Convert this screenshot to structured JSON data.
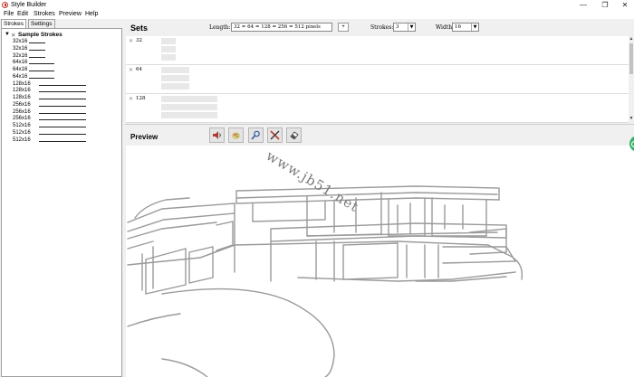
{
  "window": {
    "title": "Style Builder",
    "controls": {
      "minimize": "—",
      "maximize": "❐",
      "close": "✕"
    }
  },
  "menu": [
    "File",
    "Edit",
    "Strokes",
    "Preview",
    "Help"
  ],
  "left_panel": {
    "tabs": [
      "Strokes",
      "Settings"
    ],
    "active_tab": "Strokes",
    "tree_root": "Sample Strokes",
    "items": [
      {
        "label": "32x16",
        "stroke": "short"
      },
      {
        "label": "32x16",
        "stroke": "short"
      },
      {
        "label": "32x16",
        "stroke": "short"
      },
      {
        "label": "64x16",
        "stroke": "medium"
      },
      {
        "label": "64x16",
        "stroke": "medium"
      },
      {
        "label": "64x16",
        "stroke": "medium"
      },
      {
        "label": "128x16",
        "stroke": "long"
      },
      {
        "label": "128x16",
        "stroke": "long"
      },
      {
        "label": "128x16",
        "stroke": "long"
      },
      {
        "label": "256x16",
        "stroke": "long"
      },
      {
        "label": "256x16",
        "stroke": "long"
      },
      {
        "label": "256x16",
        "stroke": "long"
      },
      {
        "label": "512x16",
        "stroke": "long"
      },
      {
        "label": "512x16",
        "stroke": "long"
      },
      {
        "label": "512x16",
        "stroke": "long"
      }
    ]
  },
  "sets": {
    "title": "Sets",
    "length_label": "Length:",
    "length_value": "32 = 64 = 128 = 256 = 512 pixels",
    "add_button": "+",
    "strokes_label": "Strokes:",
    "strokes_value": "3",
    "width_label": "Width:",
    "width_value": "16",
    "rows": [
      {
        "label": "32",
        "slots": 3
      },
      {
        "label": "64",
        "slots": 3
      },
      {
        "label": "128",
        "slots": 3
      }
    ]
  },
  "preview": {
    "title": "Preview",
    "tools": [
      "speaker-icon",
      "palette-icon",
      "magnify-icon",
      "cross-tools-icon",
      "eraser-icon"
    ]
  },
  "watermark": "www.jb51.net",
  "colors": {
    "accent_red": "#c0392b",
    "badge_green": "#3bb16a",
    "sketch_line": "#9a9a9a"
  }
}
